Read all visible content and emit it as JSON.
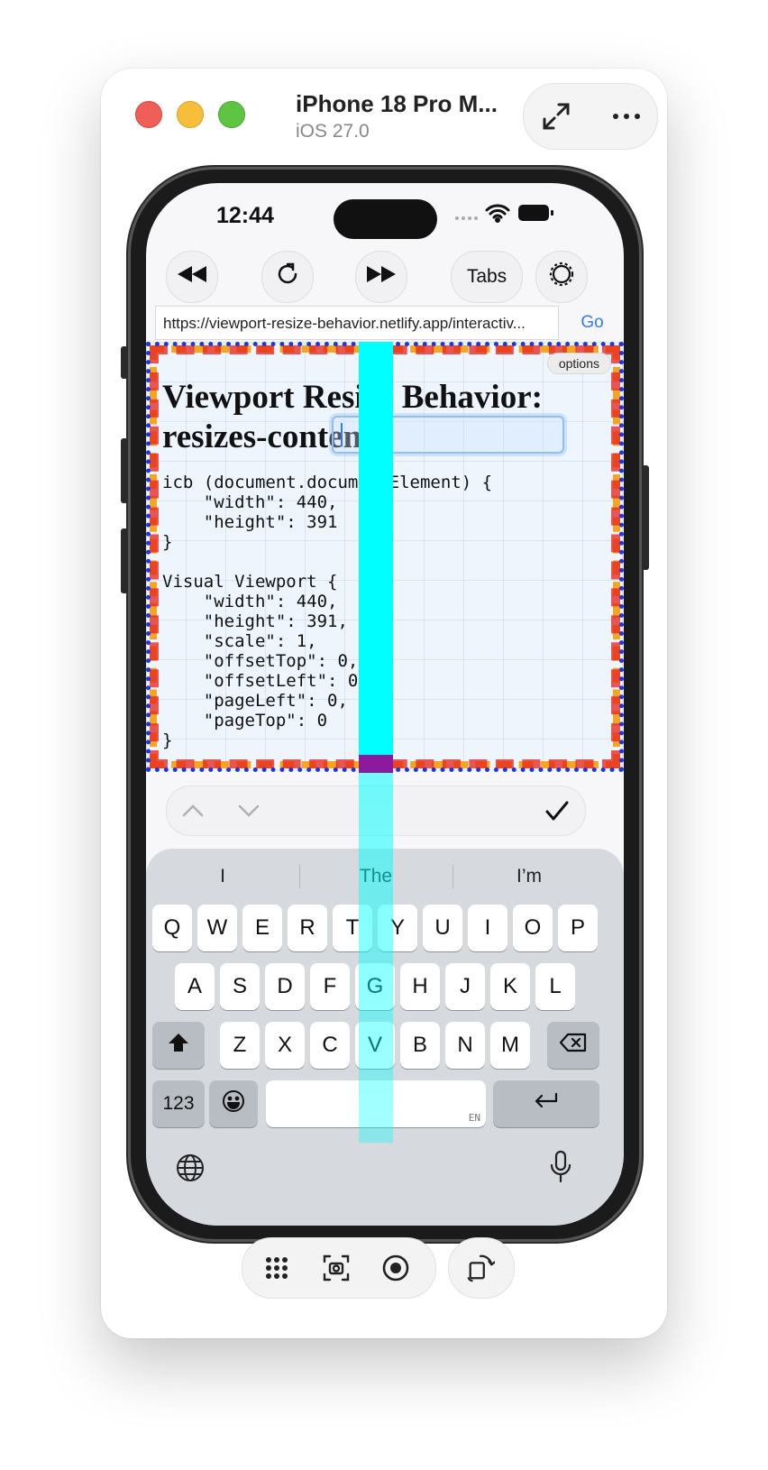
{
  "window": {
    "device_name": "iPhone 18 Pro M...",
    "os_version": "iOS 27.0"
  },
  "status_bar": {
    "time": "12:44"
  },
  "browser": {
    "tabs_label": "Tabs",
    "url": "https://viewport-resize-behavior.netlify.app/interactiv...",
    "go_label": "Go"
  },
  "page": {
    "options_label": "options",
    "title": "Viewport Resize Behavior: resizes-content",
    "code": "icb (document.documentElement) {\n    \"width\": 440,\n    \"height\": 391\n}\n\nVisual Viewport {\n    \"width\": 440,\n    \"height\": 391,\n    \"scale\": 1,\n    \"offsetTop\": 0,\n    \"offsetLeft\": 0,\n    \"pageLeft\": 0,\n    \"pageTop\": 0\n}"
  },
  "keyboard": {
    "suggestions": [
      "I",
      "The",
      "I’m"
    ],
    "row1": [
      "Q",
      "W",
      "E",
      "R",
      "T",
      "Y",
      "U",
      "I",
      "O",
      "P"
    ],
    "row2": [
      "A",
      "S",
      "D",
      "F",
      "G",
      "H",
      "J",
      "K",
      "L"
    ],
    "row3": [
      "Z",
      "X",
      "C",
      "V",
      "B",
      "N",
      "M"
    ],
    "numbers_label": "123",
    "space_lang": "EN"
  },
  "colors": {
    "accent": "#2f7cf6",
    "cyan": "#00ffff",
    "purple": "#8b1a9e",
    "dashed_orange": "#f4a623",
    "dashed_red": "#e7221b",
    "dotted_blue": "#1d35e6"
  }
}
